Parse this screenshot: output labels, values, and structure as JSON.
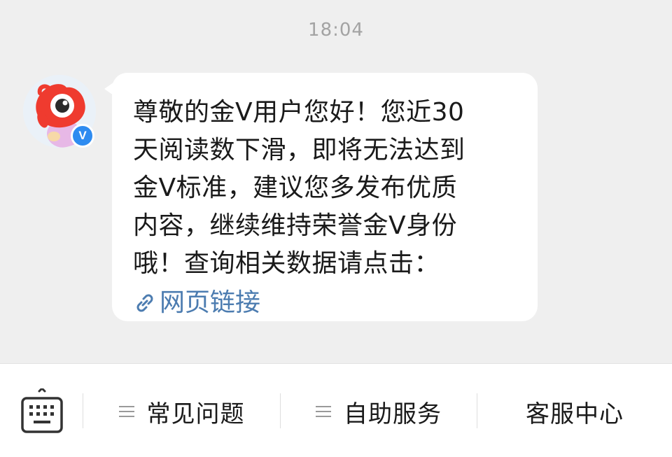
{
  "chat": {
    "timestamp": "18:04",
    "sender_badge": "V",
    "message_lines": [
      "尊敬的金V用户您好！您近30",
      "天阅读数下滑，即将无法达到",
      "金V标准，建议您多发布优质",
      "内容，继续维持荣誉金V身份",
      "哦！查询相关数据请点击："
    ],
    "link_label": "网页链接"
  },
  "bottom_menu": {
    "keyboard_icon": "keyboard-icon",
    "items": [
      {
        "label": "常见问题",
        "icon": "menu-icon"
      },
      {
        "label": "自助服务",
        "icon": "menu-icon"
      },
      {
        "label": "客服中心"
      }
    ]
  },
  "colors": {
    "background": "#efefef",
    "bubble": "#ffffff",
    "link": "#4c7cb0",
    "badge": "#2e8bf0",
    "timestamp": "#a3a3a3"
  }
}
